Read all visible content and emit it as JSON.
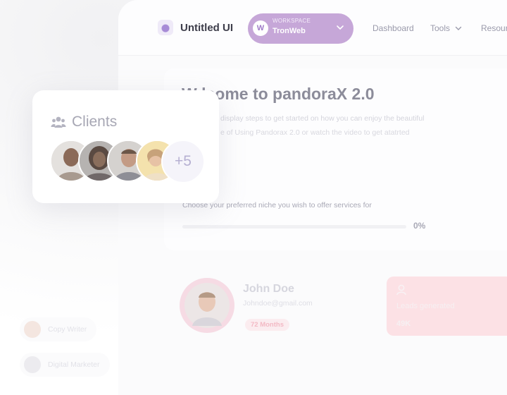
{
  "header": {
    "brand": "Untitled UI",
    "workspace": {
      "caption": "WORKSPACE",
      "name": "TronWeb",
      "avatar_letter": "W"
    },
    "nav": {
      "dashboard": "Dashboard",
      "tools": "Tools",
      "resources": "Resour"
    }
  },
  "welcome": {
    "title": "W   lcome to pandoraX 2.0",
    "subtitle_line1": "display steps to get started on how you can enjoy the beautiful",
    "subtitle_line2": "e of Using Pandorax 2.0 or watch the video to get atatrted",
    "choose_text": "Choose your preferred niche you wish to offer services for",
    "progress": {
      "value": 0,
      "label": "0%"
    }
  },
  "clients": {
    "title": "Clients",
    "more_count": "+5"
  },
  "profile": {
    "name": "John Doe",
    "email": "Johndoe@gmail.com",
    "badge": "72 Months"
  },
  "leads": {
    "title": "Leads generated",
    "value": "49K"
  },
  "chips": {
    "copy_writer": "Copy Writer",
    "digital_marketer": "Digital Marketer"
  },
  "colors": {
    "workspace_bg": "#c6a7d8",
    "accent_purple": "#a07cc8",
    "leads_bg": "#fce1e5"
  }
}
